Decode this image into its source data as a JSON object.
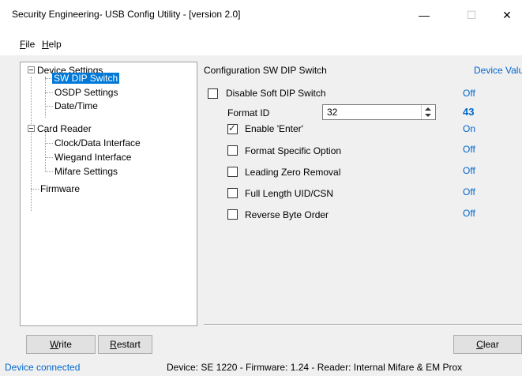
{
  "window": {
    "title": "Security Engineering- USB Config Utility - [version 2.0]",
    "minimize": "—",
    "maximize": "☐",
    "close": "✕"
  },
  "menu": {
    "file_accel": "F",
    "file_rest": "ile",
    "help_accel": "H",
    "help_rest": "elp"
  },
  "tree": {
    "device_settings": "Device Settings",
    "sw_dip_switch": "SW DIP Switch",
    "osdp_settings": "OSDP Settings",
    "date_time": "Date/Time",
    "card_reader": "Card Reader",
    "clock_data": "Clock/Data Interface",
    "wiegand": "Wiegand Interface",
    "mifare": "Mifare Settings",
    "firmware": "Firmware"
  },
  "config": {
    "group_title": "Configuration SW DIP Switch",
    "device_value_header": "Device Value",
    "disable_soft_dip": {
      "label": "Disable Soft DIP Switch",
      "checked": false,
      "value": "Off"
    },
    "format_id": {
      "label": "Format ID",
      "input": "32",
      "value": "43"
    },
    "enable_enter": {
      "label": "Enable 'Enter'",
      "checked": true,
      "value": "On"
    },
    "format_specific": {
      "label": "Format Specific Option",
      "checked": false,
      "value": "Off"
    },
    "leading_zero": {
      "label": "Leading Zero Removal",
      "checked": false,
      "value": "Off"
    },
    "full_length": {
      "label": "Full Length UID/CSN",
      "checked": false,
      "value": "Off"
    },
    "reverse_byte": {
      "label": "Reverse Byte Order",
      "checked": false,
      "value": "Off"
    }
  },
  "buttons": {
    "write_accel": "W",
    "write_rest": "rite",
    "restart_accel": "R",
    "restart_rest": "estart",
    "clear_accel": "C",
    "clear_rest": "lear"
  },
  "status": {
    "connection": "Device connected",
    "device_info": "Device: SE 1220 - Firmware: 1.24 - Reader: Internal Mifare & EM Prox"
  },
  "colors": {
    "accent": "#0066cc",
    "selection": "#0078d7"
  }
}
